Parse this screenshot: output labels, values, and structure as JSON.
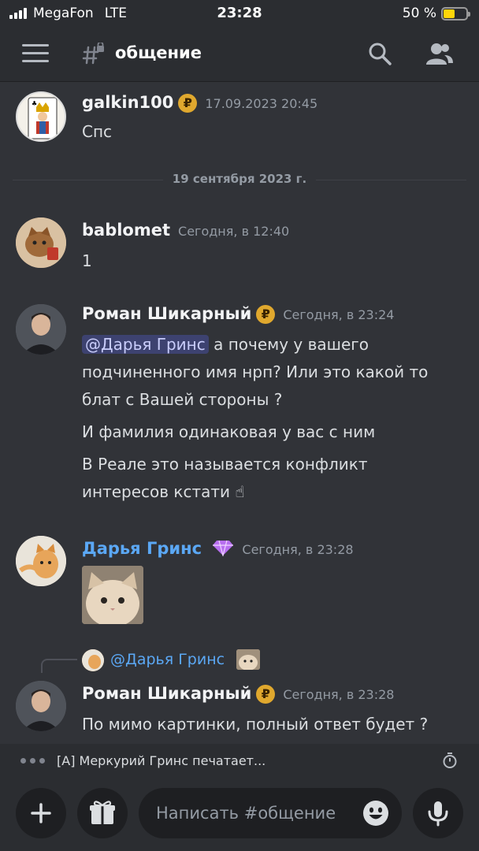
{
  "status": {
    "carrier": "MegaFon",
    "network": "LTE",
    "time": "23:28",
    "battery": "50 %",
    "battery_level": 0.5
  },
  "header": {
    "channel": "общение",
    "icons": [
      "menu-icon",
      "channel-lock-icon",
      "search-icon",
      "members-icon"
    ]
  },
  "messages": [
    {
      "author": "galkin100",
      "timestamp": "17.09.2023 20:45",
      "lines": [
        "Спс"
      ]
    },
    {
      "divider": "19 сентября 2023 г."
    },
    {
      "author": "bablomet",
      "timestamp": "Сегодня, в 12:40",
      "lines": [
        "1"
      ]
    },
    {
      "author": "Роман Шикарный",
      "timestamp": "Сегодня, в 23:24",
      "mention": "@Дарья Гринс",
      "line1_rest": " а почему у вашего",
      "lines": [
        "подчиненного имя нрп?  Или это какой то",
        "блат с Вашей стороны ?",
        "И фамилия одинаковая у вас с ним",
        "В Реале это называется конфликт",
        "интересов кстати ☝"
      ]
    },
    {
      "author": "Дарья Гринс",
      "author_color": "#5ba8f5",
      "timestamp": "Сегодня, в 23:28",
      "badge": "gem-icon"
    },
    {
      "reply_to": "@Дарья Гринс",
      "author": "Роман Шикарный",
      "timestamp": "Сегодня, в 23:28",
      "lines": [
        "По мимо картинки, полный ответ будет ?"
      ]
    }
  ],
  "typing": "[A] Меркурий Гринс печатает...",
  "composer": {
    "placeholder": "Написать #общение"
  },
  "colors": {
    "background": "#313338",
    "header": "#2b2d31",
    "mention_bg": "#3d4270",
    "link_name": "#5ba8f5",
    "nitro_badge": "#e0a82e"
  }
}
